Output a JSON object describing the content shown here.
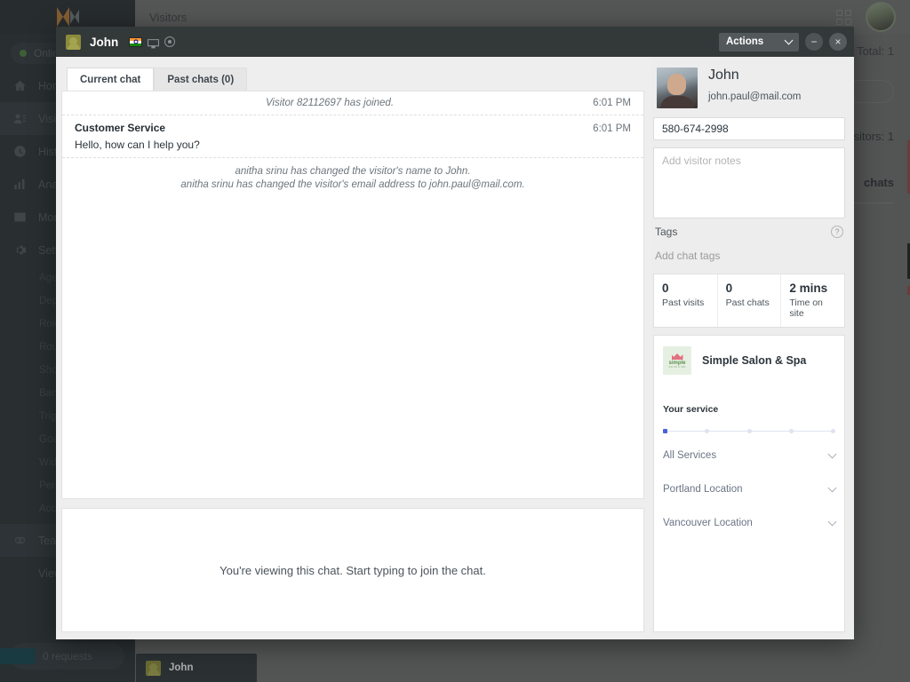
{
  "background": {
    "logo_name": "logo-mark",
    "status": "Online",
    "page_title": "Visitors",
    "total_label": "Total: 1",
    "visitors_label": "isitors: 1",
    "chats_label": "chats",
    "requests_label": "0 requests",
    "nav": [
      {
        "label": "Home",
        "icon": "home-icon"
      },
      {
        "label": "Visitors",
        "icon": "visitors-icon",
        "active": true
      },
      {
        "label": "History",
        "icon": "history-icon"
      },
      {
        "label": "Analytics",
        "icon": "analytics-icon"
      },
      {
        "label": "Monitor",
        "icon": "monitor-icon"
      },
      {
        "label": "Settings",
        "icon": "settings-icon"
      }
    ],
    "settings_sub": [
      "Agents",
      "Departments",
      "Roles",
      "Routing",
      "Shortcuts",
      "Banned",
      "Triggers",
      "Goals",
      "Widget",
      "Personal",
      "Account"
    ],
    "team_label": "Team",
    "view_label": "View"
  },
  "taskbar": {
    "items": [
      {
        "label": "John",
        "icon": "visitor-avatar-thumb"
      }
    ]
  },
  "chat_window": {
    "title": "John",
    "icons": [
      "india-flag-icon",
      "desktop-monitor-icon",
      "browser-globe-icon"
    ],
    "actions_label": "Actions",
    "minimize_label": "−",
    "close_label": "×",
    "tabs": [
      {
        "label": "Current chat",
        "active": true
      },
      {
        "label": "Past chats (0)",
        "active": false
      }
    ],
    "transcript": {
      "join_message": "Visitor 82112697 has joined.",
      "join_time": "6:01 PM",
      "agent_name": "Customer Service",
      "agent_time": "6:01 PM",
      "agent_message": "Hello, how can I help you?",
      "system_notes": [
        "anitha srinu has changed the visitor's name to John.",
        "anitha srinu has changed the visitor's email address to john.paul@mail.com."
      ]
    },
    "composer_hint": "You're viewing this chat. Start typing to join the chat."
  },
  "visitor_panel": {
    "name": "John",
    "email": "john.paul@mail.com",
    "phone_value": "580-674-2998",
    "notes_placeholder": "Add visitor notes",
    "notes_value": "",
    "tags_label": "Tags",
    "tags_help_icon": "question-mark-icon",
    "tags_placeholder": "Add chat tags",
    "stats": [
      {
        "value": "0",
        "label": "Past visits"
      },
      {
        "value": "0",
        "label": "Past chats"
      },
      {
        "value": "2 mins",
        "label": "Time on site"
      }
    ],
    "widget": {
      "brand_name": "Simple Salon & Spa",
      "brand_logo_text": "simple",
      "brand_logo_sub": "SALON & SPA",
      "service_title": "Your service",
      "stepper_total": 5,
      "stepper_active": 1,
      "rows": [
        {
          "label": "All Services",
          "icon": "chevron-down-icon"
        },
        {
          "label": "Portland Location",
          "icon": "chevron-down-icon"
        },
        {
          "label": "Vancouver Location",
          "icon": "chevron-down-icon"
        }
      ]
    }
  },
  "colors": {
    "accent": "#4a63d8",
    "sidebar": "#2f3539",
    "titlebar": "#333839",
    "online": "#4e7a3f"
  }
}
